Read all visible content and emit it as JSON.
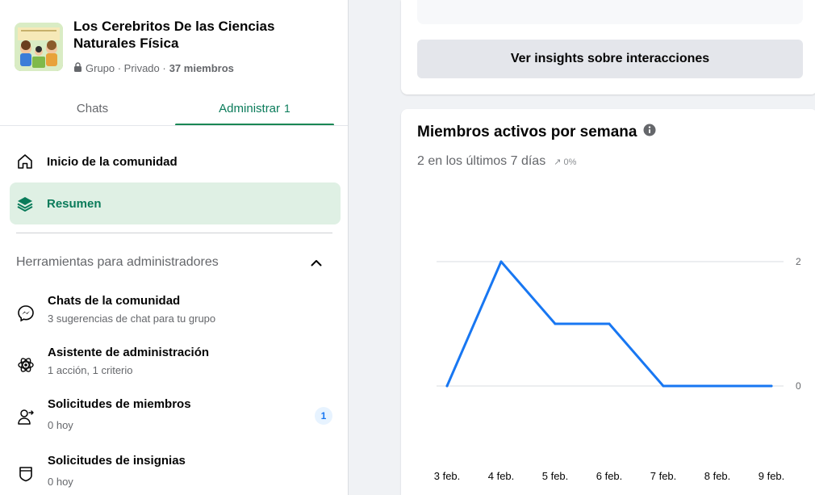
{
  "group": {
    "name": "Los Cerebritos De las Ciencias Naturales Física",
    "privacy": "Grupo · Privado ·",
    "members": "37 miembros"
  },
  "tabs": {
    "chats": "Chats",
    "admin": "Administrar",
    "admin_count": "1"
  },
  "nav": [
    {
      "label": "Inicio de la comunidad",
      "icon": "home-icon"
    },
    {
      "label": "Resumen",
      "icon": "layers-icon",
      "active": true
    }
  ],
  "admin_tools": {
    "title": "Herramientas para administradores",
    "items": [
      {
        "title": "Chats de la comunidad",
        "subtitle": "3 sugerencias de chat para tu grupo",
        "icon": "messenger-icon"
      },
      {
        "title": "Asistente de administración",
        "subtitle": "1 acción, 1 criterio",
        "icon": "atom-icon"
      },
      {
        "title": "Solicitudes de miembros",
        "subtitle": "0 hoy",
        "icon": "add-person-icon",
        "badge": "1"
      },
      {
        "title": "Solicitudes de insignias",
        "subtitle": "0 hoy",
        "icon": "shield-icon"
      }
    ]
  },
  "insights_button": "Ver insights sobre interacciones",
  "chart_card": {
    "title": "Miembros activos por semana",
    "subtitle": "2 en los últimos 7 días",
    "delta": "↗ 0%"
  },
  "colors": {
    "accent_green": "#0a7b5a",
    "line_blue": "#1877f2",
    "active_bg": "#dff0e4"
  },
  "chart_data": {
    "type": "line",
    "categories": [
      "3 feb.",
      "4 feb.",
      "5 feb.",
      "6 feb.",
      "7 feb.",
      "8 feb.",
      "9 feb."
    ],
    "series": [
      {
        "values": [
          0,
          2,
          1,
          1,
          0,
          0,
          0
        ]
      }
    ],
    "yticks": [
      0,
      2
    ],
    "ylim": [
      0,
      2
    ],
    "grid": true
  }
}
